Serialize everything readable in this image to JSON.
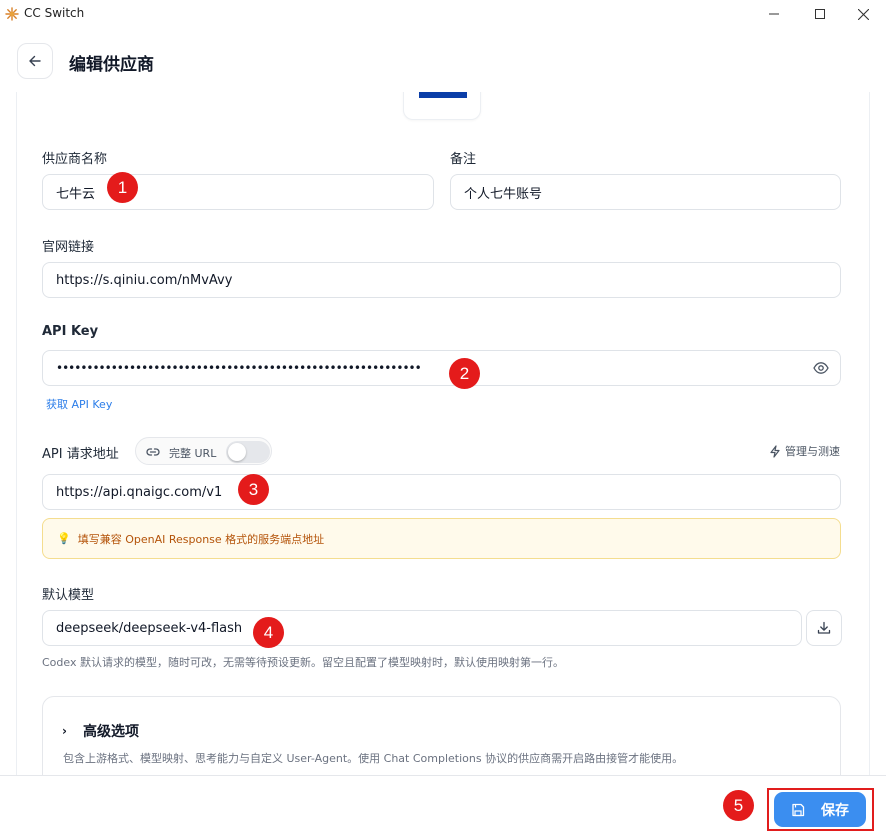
{
  "window": {
    "title": "CC Switch"
  },
  "header": {
    "title": "编辑供应商"
  },
  "form": {
    "provider_name": {
      "label": "供应商名称",
      "value": "七牛云"
    },
    "notes": {
      "label": "备注",
      "value": "个人七牛账号"
    },
    "website": {
      "label": "官网链接",
      "value": "https://s.qiniu.com/nMvAvy"
    },
    "api_key": {
      "label": "API Key",
      "value": "••••••••••••••••••••••••••••••••••••••••••••••••••••••••••••",
      "link": "获取 API Key"
    },
    "api_url": {
      "label": "API 请求地址",
      "toggle_label": "完整 URL",
      "toggle_on": false,
      "manage_label": "管理与测速",
      "value": "https://api.qnaigc.com/v1",
      "hint": "填写兼容 OpenAI Response 格式的服务端点地址"
    },
    "default_model": {
      "label": "默认模型",
      "value": "deepseek/deepseek-v4-flash",
      "help": "Codex 默认请求的模型，随时可改，无需等待预设更新。留空且配置了模型映射时，默认使用映射第一行。"
    }
  },
  "advanced": {
    "title": "高级选项",
    "description": "包含上游格式、模型映射、思考能力与自定义 User-Agent。使用 Chat Completions 协议的供应商需开启路由接管才能使用。"
  },
  "footer": {
    "save_label": "保存"
  },
  "markers": [
    "1",
    "2",
    "3",
    "4",
    "5"
  ],
  "colors": {
    "accent": "#3b8ef0",
    "marker": "#e41b1b",
    "hint_bg": "#fffaeb",
    "hint_text": "#b45309",
    "link": "#2b7de9"
  },
  "icons": [
    "app-logo-icon",
    "minimize-icon",
    "maximize-icon",
    "close-icon",
    "back-arrow-icon",
    "eye-icon",
    "link-icon",
    "zap-icon",
    "lightbulb-icon",
    "download-icon",
    "chevron-right-icon",
    "save-icon"
  ]
}
